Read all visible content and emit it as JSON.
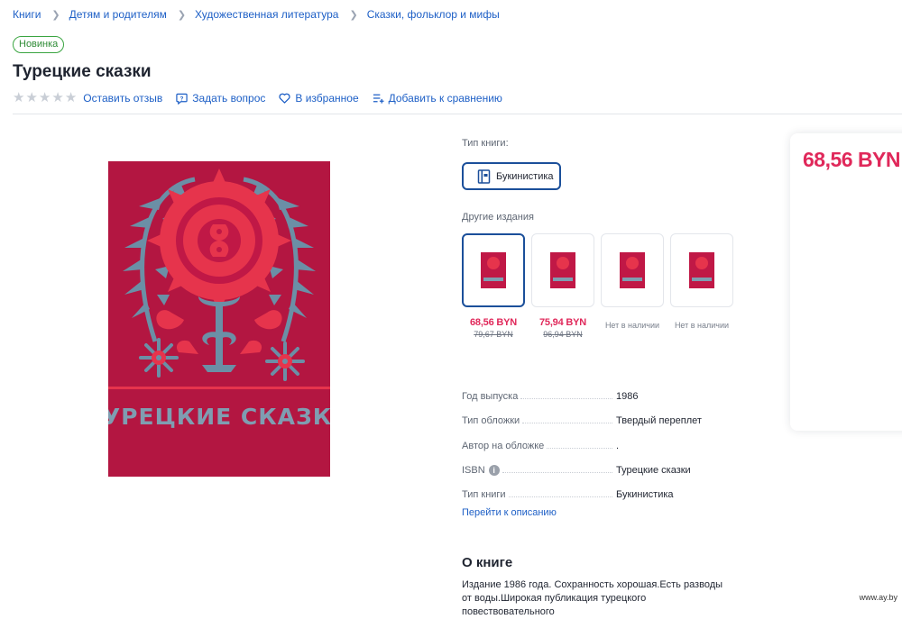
{
  "breadcrumb": [
    "Книги",
    "Детям и родителям",
    "Художественная литература",
    "Сказки, фольклор и мифы"
  ],
  "badge": "Новинка",
  "title": "Турецкие сказки",
  "rating": {
    "stars_filled": 0,
    "stars_total": 5
  },
  "actions": {
    "review": "Оставить отзыв",
    "question": "Задать вопрос",
    "favorite": "В избранное",
    "compare": "Добавить к сравнению"
  },
  "book_type": {
    "label": "Тип книги:",
    "option": "Букинистика"
  },
  "other_editions": {
    "label": "Другие издания",
    "items": [
      {
        "price": "68,56 BYN",
        "old_price": "79,67 BYN",
        "status": ""
      },
      {
        "price": "75,94 BYN",
        "old_price": "96,94 BYN",
        "status": ""
      },
      {
        "price": "",
        "old_price": "",
        "status": "Нет в наличии"
      },
      {
        "price": "",
        "old_price": "",
        "status": "Нет в наличии"
      }
    ]
  },
  "specs": [
    {
      "label": "Год выпуска",
      "value": "1986"
    },
    {
      "label": "Тип обложки",
      "value": "Твердый переплет"
    },
    {
      "label": "Автор на обложке",
      "value": "."
    },
    {
      "label": "ISBN",
      "value": "Турецкие сказки"
    },
    {
      "label": "Тип книги",
      "value": "Букинистика"
    }
  ],
  "description_link": "Перейти к описанию",
  "about": {
    "title": "О книге",
    "text": "Издание 1986 года. Сохранность хорошая.Есть разводы от воды.Широкая публикация турецкого повествовательного"
  },
  "price": "68,56 BYN",
  "cover": {
    "title_text": "ТУРЕЦКИЕ СКАЗКИ"
  },
  "watermark": "www.ay.by",
  "colors": {
    "link": "#1d5fc6",
    "price": "#e0285a",
    "badge": "#3aa541",
    "cover": "#c01846"
  }
}
